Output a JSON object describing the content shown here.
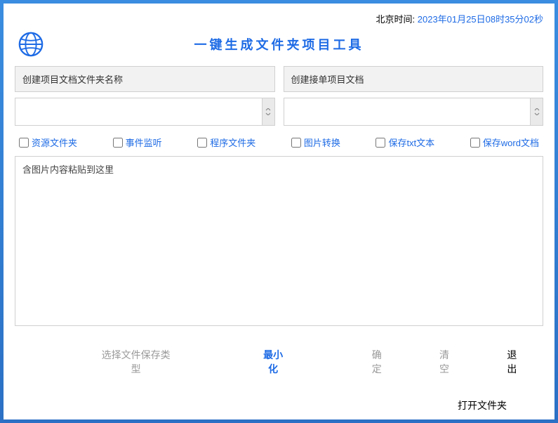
{
  "topbar": {
    "time_label": "北京时间: ",
    "time_value": "2023年01月25日08时35分02秒"
  },
  "header": {
    "title": "一键生成文件夹项目工具"
  },
  "fields": {
    "left_label": "创建项目文档文件夹名称",
    "right_label": "创建接单项目文档",
    "left_value": "",
    "right_value": ""
  },
  "checks": [
    {
      "label": "资源文件夹"
    },
    {
      "label": "事件监听"
    },
    {
      "label": "程序文件夹"
    },
    {
      "label": "图片转换"
    },
    {
      "label": "保存txt文本"
    },
    {
      "label": "保存word文档"
    }
  ],
  "textarea": {
    "placeholder": "含图片内容粘贴到这里",
    "value": ""
  },
  "buttons": {
    "save_type": "选择文件保存类型",
    "minimize": "最小化",
    "confirm": "确定",
    "clear": "清空",
    "exit": "退出",
    "open_folder": "打开文件夹"
  }
}
